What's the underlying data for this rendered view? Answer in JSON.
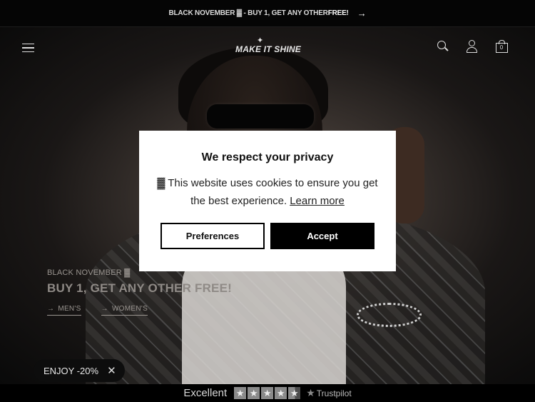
{
  "announcement": {
    "text": "BLACK NOVEMBER ▓ - BUY 1, GET ANY OTHER ",
    "strong": "FREE!",
    "arrow": "→"
  },
  "header": {
    "logo": "MAKE IT SHINE",
    "logo_star": "✦",
    "icons": [
      "menu-icon",
      "search-icon",
      "account-icon",
      "cart-icon"
    ],
    "cart_count": "0"
  },
  "hero": {
    "eyebrow": "BLACK NOVEMBER ▓",
    "headline": "BUY 1, GET ANY OTHER FREE!",
    "links": [
      {
        "arrow": "→",
        "label": "MEN'S"
      },
      {
        "arrow": "→",
        "label": "WOMEN'S"
      }
    ]
  },
  "discount_pill": {
    "label": "ENJOY -20%",
    "close": "✕"
  },
  "trustpilot": {
    "rating_word": "Excellent",
    "stars": [
      "★",
      "★",
      "★",
      "★",
      "★"
    ],
    "logo_star": "★",
    "brand": "Trustpilot",
    "star_color": "#8a8a8a"
  },
  "cookie_modal": {
    "title": "We respect your privacy",
    "body": "▓ This website uses cookies to ensure you get the best experience.",
    "learn_more": "Learn more",
    "preferences_label": "Preferences",
    "accept_label": "Accept"
  },
  "colors": {
    "announce_bg": "#050505",
    "modal_bg": "#ffffff",
    "accept_bg": "#000000"
  }
}
